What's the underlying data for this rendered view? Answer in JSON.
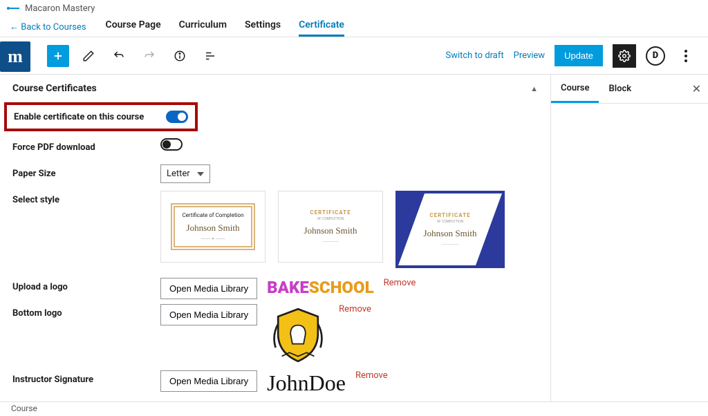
{
  "header": {
    "page_title": "Macaron Mastery",
    "back_link": "← Back to Courses",
    "tabs": [
      "Course Page",
      "Curriculum",
      "Settings",
      "Certificate"
    ],
    "active_tab": "Certificate"
  },
  "editor_toolbar": {
    "switch_draft": "Switch to draft",
    "preview": "Preview",
    "update": "Update"
  },
  "panel": {
    "title": "Course Certificates",
    "enable_label": "Enable certificate on this course",
    "enable_value": true,
    "force_pdf_label": "Force PDF download",
    "force_pdf_value": false,
    "paper_size_label": "Paper Size",
    "paper_size_value": "Letter",
    "select_style_label": "Select style",
    "upload_logo_label": "Upload a logo",
    "bottom_logo_label": "Bottom logo",
    "instructor_sig_label": "Instructor Signature",
    "open_media": "Open Media Library",
    "remove": "Remove"
  },
  "certificates": {
    "thumb_title_1": "Certificate of Completion",
    "thumb_title_2": "CERTIFICATE",
    "thumb_sub": "OF COMPLETION",
    "thumb_name": "Johnson Smith"
  },
  "logos": {
    "bake_a": "BAKE",
    "bake_b": "SCHOOL",
    "signature": "JohnDoe"
  },
  "side": {
    "tab_course": "Course",
    "tab_block": "Block"
  },
  "bottom": {
    "breadcrumb": "Course"
  }
}
